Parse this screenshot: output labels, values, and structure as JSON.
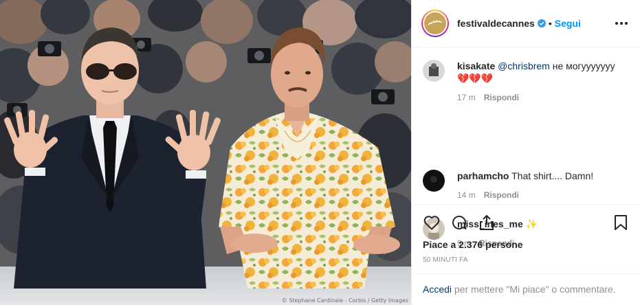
{
  "photo": {
    "credit": "© Stephane Cardinale - Corbis / Getty Images"
  },
  "post": {
    "username": "festivaldecannes",
    "separator": "•",
    "follow_label": "Segui",
    "likes_text": "Piace a 2.376 persone",
    "time_ago": "50 MINUTI FA"
  },
  "comments": [
    {
      "user": "kisakate",
      "mention": "@chrisbrem",
      "text": " не могууууууу",
      "emoji": "💔💔💔",
      "time": "17 m",
      "reply": "Rispondi"
    },
    {
      "user": "parhamcho",
      "mention": "",
      "text": " That shirt.... Damn!",
      "emoji": "",
      "time": "14 m",
      "reply": "Rispondi"
    },
    {
      "user": "miss_ines_me",
      "mention": "",
      "text": " ",
      "emoji": "✨",
      "time": "9 m",
      "reply": "Rispondi"
    }
  ],
  "login_prompt": {
    "link": "Accedi",
    "text": " per mettere \"Mi piace\" o commentare."
  },
  "colors": {
    "link_blue": "#0095f6",
    "mention_blue": "#00376b",
    "meta_gray": "#8e8e8e",
    "shirt_yellow": "#f3b635",
    "suit_navy": "#1c2230"
  },
  "icons": [
    "verified-icon",
    "more-icon",
    "heart-icon",
    "comment-icon",
    "share-icon",
    "bookmark-icon"
  ]
}
